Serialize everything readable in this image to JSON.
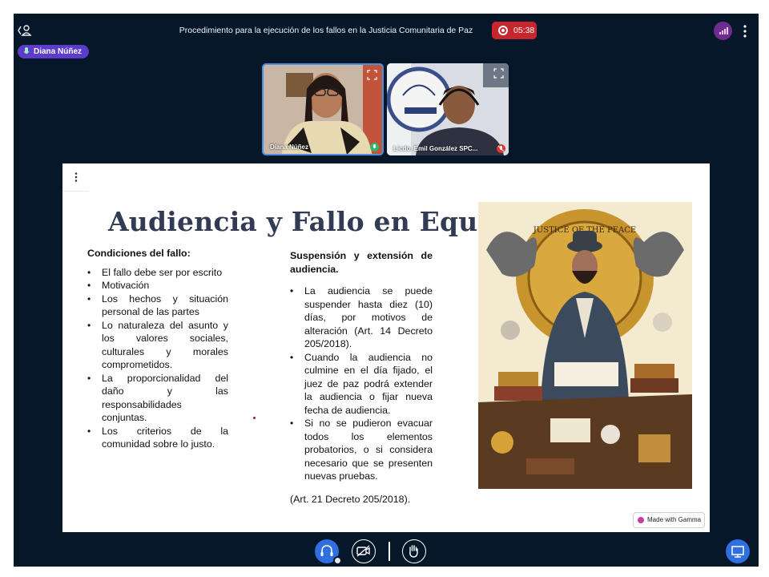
{
  "header": {
    "title": "Procedimiento para la ejecución de los fallos en la Justicia Comunitaria de Paz",
    "recording_time": "05:38",
    "talking_indicator": "Diana Núñez"
  },
  "participants": [
    {
      "name": "Diana Núñez",
      "mic": "on"
    },
    {
      "name": "Licdo. Emil González SPC...",
      "mic": "off"
    }
  ],
  "slide": {
    "title": "Audiencia y Fallo en Equidad",
    "left_heading": "Condiciones del fallo:",
    "left_bullets": [
      "El fallo debe ser por escrito",
      "Motivación",
      "Los hechos y situación personal de las partes",
      "Lo naturaleza del asunto y los valores sociales, culturales y morales comprometidos.",
      "La proporcionalidad del daño y las responsabilidades conjuntas.",
      "Los criterios de la comunidad sobre lo justo."
    ],
    "right_heading": "Suspensión y extensión de audiencia.",
    "right_bullets": [
      "La audiencia se puede suspender hasta diez (10) días, por motivos de alteración (Art. 14 Decreto 205/2018).",
      "Cuando la audiencia no culmine en el día fijado, el juez de paz podrá extender la audiencia o fijar nueva fecha de audiencia.",
      "Si no se pudieron evacuar todos los elementos probatorios, o si considera necesario que se presenten nuevas pruebas."
    ],
    "right_reference": "(Art. 21 Decreto 205/2018).",
    "image_text": "JUSTICE OF THE PEACE",
    "badge": "Made with Gamma"
  },
  "colors": {
    "background": "#06172a",
    "record": "#c8262f",
    "accent_blue": "#2f6fe0",
    "talker": "#5b3dc9",
    "slide_title": "#333b54"
  },
  "icons": [
    "back-user-icon",
    "record-icon",
    "connection-status-icon",
    "more-options-icon",
    "microphone-icon",
    "expand-icon",
    "muted-microphone-icon",
    "headphones-icon",
    "camera-off-icon",
    "raise-hand-icon",
    "presentation-icon"
  ]
}
